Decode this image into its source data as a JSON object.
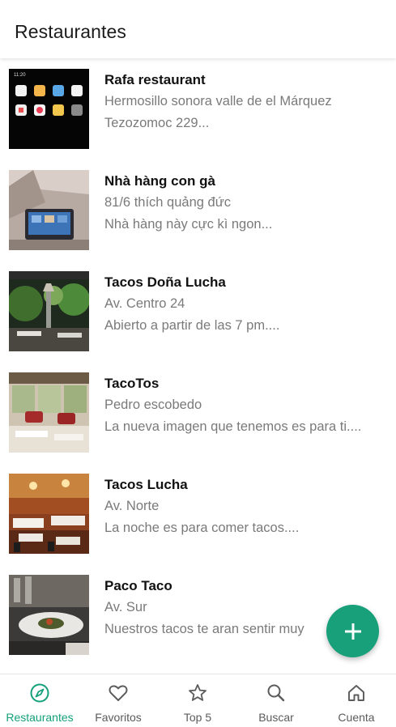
{
  "header": {
    "title": "Restaurantes"
  },
  "restaurants": [
    {
      "name": "Rafa restaurant",
      "address": "Hermosillo sonora valle de el Márquez",
      "description": "Tezozomoc 229..."
    },
    {
      "name": "Nhà hàng con gà",
      "address": "81/6 thích quảng đức",
      "description": "Nhà hàng này cực kì ngon..."
    },
    {
      "name": "Tacos Doña Lucha",
      "address": "Av. Centro 24",
      "description": "Abierto a partir de las 7 pm...."
    },
    {
      "name": "TacoTos",
      "address": "Pedro escobedo",
      "description": "La nueva imagen que tenemos es para ti...."
    },
    {
      "name": "Tacos Lucha",
      "address": "Av. Norte",
      "description": "La noche es para comer tacos...."
    },
    {
      "name": "Paco Taco",
      "address": "Av. Sur",
      "description": "Nuestros tacos te aran sentir muy"
    }
  ],
  "fab": {
    "icon": "plus-icon"
  },
  "nav": {
    "active": 0,
    "active_color": "#13a07a",
    "items": [
      {
        "label": "Restaurantes",
        "icon": "compass-icon"
      },
      {
        "label": "Favoritos",
        "icon": "heart-icon"
      },
      {
        "label": "Top 5",
        "icon": "star-icon"
      },
      {
        "label": "Buscar",
        "icon": "search-icon"
      },
      {
        "label": "Cuenta",
        "icon": "home-icon"
      }
    ]
  }
}
